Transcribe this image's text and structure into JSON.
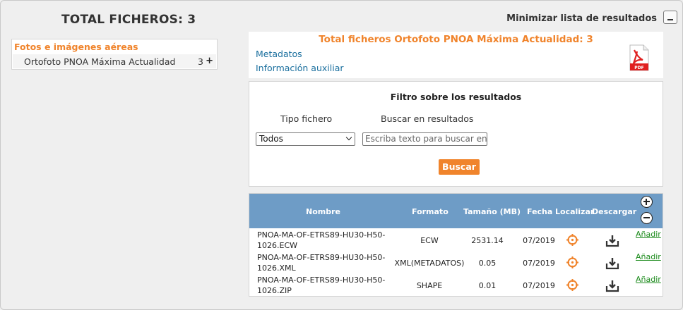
{
  "header": {
    "total_title": "TOTAL FICHEROS: 3",
    "minimize_label": "Minimizar lista de resultados"
  },
  "categories": {
    "title": "Fotos e imágenes aéreas",
    "items": [
      {
        "name": "Ortofoto PNOA Máxima Actualidad",
        "count": "3",
        "action": "+"
      }
    ]
  },
  "summary": {
    "title": "Total ficheros  Ortofoto PNOA Máxima Actualidad: 3",
    "links": [
      "Metadatos",
      "Información auxiliar"
    ],
    "pdf_icon": "pdf-file-icon",
    "pdf_text": "PDF"
  },
  "filter": {
    "title": "Filtro sobre los resultados",
    "type_label": "Tipo fichero",
    "search_label": "Buscar en resultados",
    "type_selected": "Todos",
    "search_placeholder": "Escriba texto para buscar en",
    "search_button": "Buscar"
  },
  "table": {
    "columns": [
      "Nombre",
      "Formato",
      "Tamaño (MB)",
      "Fecha",
      "Localizar",
      "Descargar"
    ],
    "add_label": "Añadir",
    "rows": [
      {
        "name": "PNOA-MA-OF-ETRS89-HU30-H50-1026.ECW",
        "format": "ECW",
        "size": "2531.14",
        "date": "07/2019"
      },
      {
        "name": "PNOA-MA-OF-ETRS89-HU30-H50-1026.XML",
        "format": "XML(METADATOS)",
        "size": "0.05",
        "date": "07/2019"
      },
      {
        "name": "PNOA-MA-OF-ETRS89-HU30-H50-1026.ZIP",
        "format": "SHAPE",
        "size": "0.01",
        "date": "07/2019"
      }
    ]
  },
  "colors": {
    "accent_orange": "#f0842c",
    "header_blue": "#6e9cc6",
    "link_blue": "#1a6f9e",
    "link_green": "#1a8a1a"
  }
}
